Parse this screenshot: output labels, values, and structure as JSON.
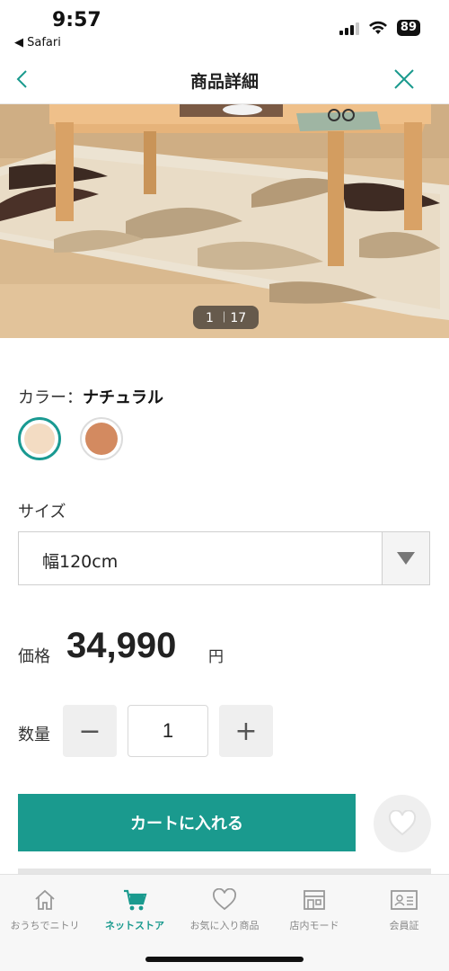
{
  "status_bar": {
    "time": "9:57",
    "back_app": "◀ Safari",
    "battery": "89"
  },
  "nav": {
    "title": "商品詳細"
  },
  "gallery": {
    "counter": "1 ︱17"
  },
  "color": {
    "label": "カラー：",
    "selected": "ナチュラル",
    "swatches": [
      {
        "name": "ナチュラル",
        "hex": "#f3dcc3",
        "selected": true
      },
      {
        "name": "",
        "hex": "#d38a60",
        "selected": false
      }
    ]
  },
  "size": {
    "label": "サイズ",
    "selected": "幅120cm"
  },
  "price": {
    "label": "価格",
    "value": "34,990",
    "unit": "円"
  },
  "quantity": {
    "label": "数量",
    "minus": "−",
    "value": "1",
    "plus": "+"
  },
  "cart": {
    "button_label": "カートに入れる"
  },
  "tab_bar": {
    "items": [
      {
        "label": "おうちでニトリ",
        "icon": "house-icon",
        "active": false
      },
      {
        "label": "ネットストア",
        "icon": "cart-icon",
        "active": true
      },
      {
        "label": "お気に入り商品",
        "icon": "heart-icon",
        "active": false
      },
      {
        "label": "店内モード",
        "icon": "store-icon",
        "active": false
      },
      {
        "label": "会員証",
        "icon": "member-card-icon",
        "active": false
      }
    ]
  },
  "colors": {
    "accent": "#1a9a8e"
  }
}
